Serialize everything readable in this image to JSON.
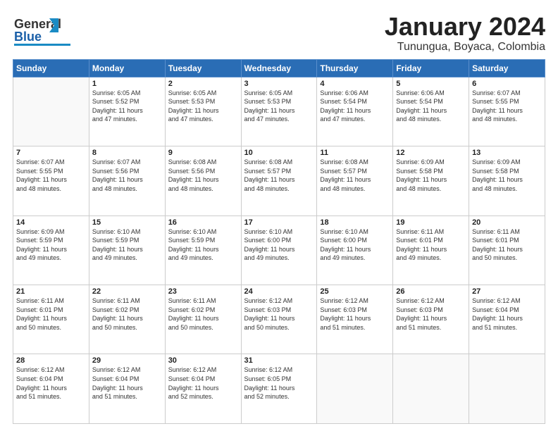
{
  "logo": {
    "line1": "General",
    "line2": "Blue"
  },
  "title": "January 2024",
  "subtitle": "Tunungua, Boyaca, Colombia",
  "days": [
    "Sunday",
    "Monday",
    "Tuesday",
    "Wednesday",
    "Thursday",
    "Friday",
    "Saturday"
  ],
  "weeks": [
    [
      {
        "num": "",
        "info": ""
      },
      {
        "num": "1",
        "info": "Sunrise: 6:05 AM\nSunset: 5:52 PM\nDaylight: 11 hours\nand 47 minutes."
      },
      {
        "num": "2",
        "info": "Sunrise: 6:05 AM\nSunset: 5:53 PM\nDaylight: 11 hours\nand 47 minutes."
      },
      {
        "num": "3",
        "info": "Sunrise: 6:05 AM\nSunset: 5:53 PM\nDaylight: 11 hours\nand 47 minutes."
      },
      {
        "num": "4",
        "info": "Sunrise: 6:06 AM\nSunset: 5:54 PM\nDaylight: 11 hours\nand 47 minutes."
      },
      {
        "num": "5",
        "info": "Sunrise: 6:06 AM\nSunset: 5:54 PM\nDaylight: 11 hours\nand 48 minutes."
      },
      {
        "num": "6",
        "info": "Sunrise: 6:07 AM\nSunset: 5:55 PM\nDaylight: 11 hours\nand 48 minutes."
      }
    ],
    [
      {
        "num": "7",
        "info": "Sunrise: 6:07 AM\nSunset: 5:55 PM\nDaylight: 11 hours\nand 48 minutes."
      },
      {
        "num": "8",
        "info": "Sunrise: 6:07 AM\nSunset: 5:56 PM\nDaylight: 11 hours\nand 48 minutes."
      },
      {
        "num": "9",
        "info": "Sunrise: 6:08 AM\nSunset: 5:56 PM\nDaylight: 11 hours\nand 48 minutes."
      },
      {
        "num": "10",
        "info": "Sunrise: 6:08 AM\nSunset: 5:57 PM\nDaylight: 11 hours\nand 48 minutes."
      },
      {
        "num": "11",
        "info": "Sunrise: 6:08 AM\nSunset: 5:57 PM\nDaylight: 11 hours\nand 48 minutes."
      },
      {
        "num": "12",
        "info": "Sunrise: 6:09 AM\nSunset: 5:58 PM\nDaylight: 11 hours\nand 48 minutes."
      },
      {
        "num": "13",
        "info": "Sunrise: 6:09 AM\nSunset: 5:58 PM\nDaylight: 11 hours\nand 48 minutes."
      }
    ],
    [
      {
        "num": "14",
        "info": "Sunrise: 6:09 AM\nSunset: 5:59 PM\nDaylight: 11 hours\nand 49 minutes."
      },
      {
        "num": "15",
        "info": "Sunrise: 6:10 AM\nSunset: 5:59 PM\nDaylight: 11 hours\nand 49 minutes."
      },
      {
        "num": "16",
        "info": "Sunrise: 6:10 AM\nSunset: 5:59 PM\nDaylight: 11 hours\nand 49 minutes."
      },
      {
        "num": "17",
        "info": "Sunrise: 6:10 AM\nSunset: 6:00 PM\nDaylight: 11 hours\nand 49 minutes."
      },
      {
        "num": "18",
        "info": "Sunrise: 6:10 AM\nSunset: 6:00 PM\nDaylight: 11 hours\nand 49 minutes."
      },
      {
        "num": "19",
        "info": "Sunrise: 6:11 AM\nSunset: 6:01 PM\nDaylight: 11 hours\nand 49 minutes."
      },
      {
        "num": "20",
        "info": "Sunrise: 6:11 AM\nSunset: 6:01 PM\nDaylight: 11 hours\nand 50 minutes."
      }
    ],
    [
      {
        "num": "21",
        "info": "Sunrise: 6:11 AM\nSunset: 6:01 PM\nDaylight: 11 hours\nand 50 minutes."
      },
      {
        "num": "22",
        "info": "Sunrise: 6:11 AM\nSunset: 6:02 PM\nDaylight: 11 hours\nand 50 minutes."
      },
      {
        "num": "23",
        "info": "Sunrise: 6:11 AM\nSunset: 6:02 PM\nDaylight: 11 hours\nand 50 minutes."
      },
      {
        "num": "24",
        "info": "Sunrise: 6:12 AM\nSunset: 6:03 PM\nDaylight: 11 hours\nand 50 minutes."
      },
      {
        "num": "25",
        "info": "Sunrise: 6:12 AM\nSunset: 6:03 PM\nDaylight: 11 hours\nand 51 minutes."
      },
      {
        "num": "26",
        "info": "Sunrise: 6:12 AM\nSunset: 6:03 PM\nDaylight: 11 hours\nand 51 minutes."
      },
      {
        "num": "27",
        "info": "Sunrise: 6:12 AM\nSunset: 6:04 PM\nDaylight: 11 hours\nand 51 minutes."
      }
    ],
    [
      {
        "num": "28",
        "info": "Sunrise: 6:12 AM\nSunset: 6:04 PM\nDaylight: 11 hours\nand 51 minutes."
      },
      {
        "num": "29",
        "info": "Sunrise: 6:12 AM\nSunset: 6:04 PM\nDaylight: 11 hours\nand 51 minutes."
      },
      {
        "num": "30",
        "info": "Sunrise: 6:12 AM\nSunset: 6:04 PM\nDaylight: 11 hours\nand 52 minutes."
      },
      {
        "num": "31",
        "info": "Sunrise: 6:12 AM\nSunset: 6:05 PM\nDaylight: 11 hours\nand 52 minutes."
      },
      {
        "num": "",
        "info": ""
      },
      {
        "num": "",
        "info": ""
      },
      {
        "num": "",
        "info": ""
      }
    ]
  ]
}
